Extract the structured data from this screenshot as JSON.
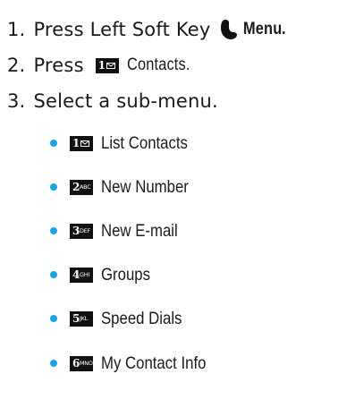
{
  "steps": [
    {
      "num": "1.",
      "text": "Press Left Soft Key ",
      "key_text": "Menu",
      "suffix": ".",
      "icon": "left-soft-key-icon"
    },
    {
      "num": "2.",
      "text": "Press ",
      "key_label": "1",
      "key_icon": "envelope-icon",
      "after": "Contacts."
    },
    {
      "num": "3.",
      "text": "Select a sub-menu."
    }
  ],
  "submenu": [
    {
      "key": "1",
      "key_sub": "",
      "key_icon": "envelope-icon",
      "label": "List Contacts"
    },
    {
      "key": "2",
      "key_sub": "ABC",
      "label": "New Number"
    },
    {
      "key": "3",
      "key_sub": "DEF",
      "label": "New E-mail"
    },
    {
      "key": "4",
      "key_sub": "GHI",
      "label": "Groups"
    },
    {
      "key": "5",
      "key_sub": "JKL",
      "label": "Speed Dials"
    },
    {
      "key": "6",
      "key_sub": "MNO",
      "label": "My Contact Info"
    }
  ],
  "colors": {
    "bullet": "#1aa3e4",
    "key_bg": "#111111",
    "text": "#1a1a1a"
  }
}
